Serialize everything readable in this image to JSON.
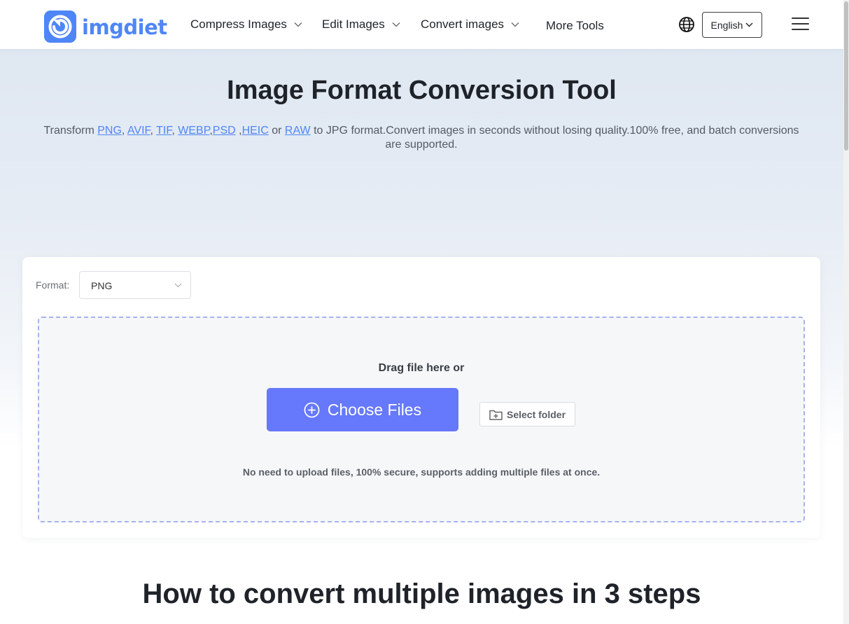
{
  "brand": {
    "name": "imgdiet",
    "color": "#4f86f7"
  },
  "nav": {
    "compress_label": "Compress Images",
    "edit_label": "Edit Images",
    "convert_label": "Convert images",
    "more_label": "More Tools"
  },
  "header": {
    "language": "English",
    "globe_icon": "globe-icon",
    "menu_icon": "hamburger-menu-icon"
  },
  "hero": {
    "title": "Image Format Conversion Tool",
    "sub_prefix": "Transform ",
    "links": [
      "PNG",
      "AVIF",
      "TIF",
      "WEBP",
      "PSD",
      "HEIC",
      "RAW"
    ],
    "sub_or": " or ",
    "sub_suffix": " to JPG format.Convert images in seconds without losing quality.100% free, and batch conversions are supported.",
    "link_color": "#4f86f7"
  },
  "tool": {
    "format_label": "Format:",
    "format_value": "PNG",
    "drag_text": "Drag file here or",
    "choose_label": "Choose Files",
    "choose_color": "#6678fb",
    "folder_label": "Select folder",
    "secure_text": "No need to upload files, 100% secure, supports adding multiple files at once."
  },
  "steps": {
    "title": "How to convert multiple images in 3 steps"
  }
}
